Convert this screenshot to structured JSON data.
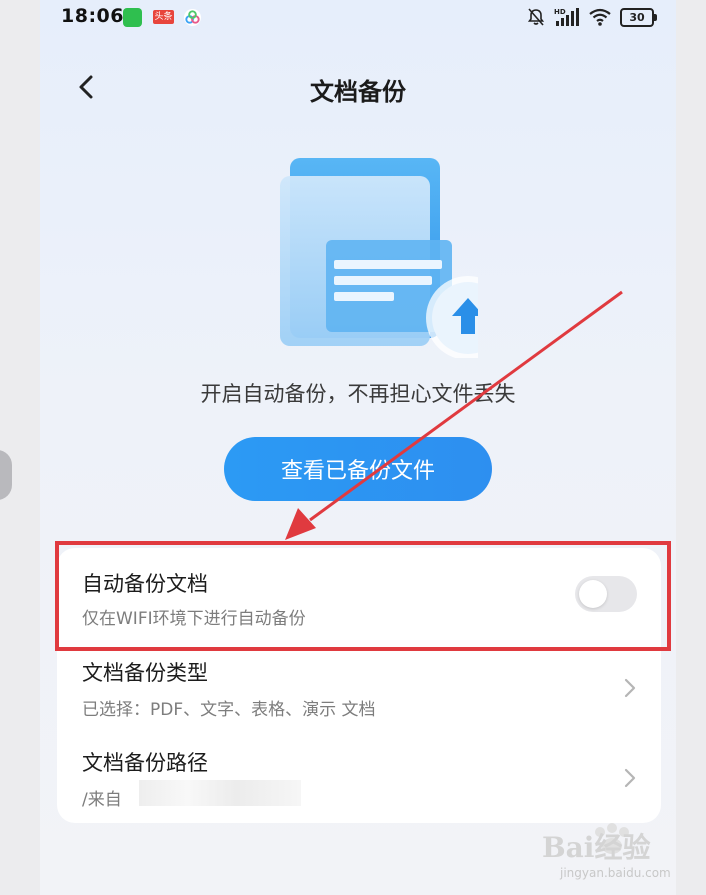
{
  "status_bar": {
    "time": "18:06",
    "apps": [
      "evernote-green",
      "toutiao-red",
      "cloud-app"
    ],
    "toutiao_label": "头条",
    "battery": "30",
    "icons": [
      "mute-bell-icon",
      "hd-signal-icon",
      "wifi-icon",
      "battery-icon"
    ]
  },
  "header": {
    "title": "文档备份",
    "back_icon": "chevron-left-icon"
  },
  "hero": {
    "tagline": "开启自动备份，不再担心文件丢失",
    "view_button": "查看已备份文件"
  },
  "settings": {
    "auto_backup": {
      "title": "自动备份文档",
      "subtitle": "仅在WIFI环境下进行自动备份",
      "enabled": false
    },
    "backup_type": {
      "title": "文档备份类型",
      "subtitle": "已选择：PDF、文字、表格、演示 文档"
    },
    "backup_path": {
      "title": "文档备份路径",
      "subtitle": "/来自"
    }
  },
  "watermark": {
    "text": "Bai经验",
    "url": "jingyan.baidu.com"
  },
  "colors": {
    "accent": "#2c9af4",
    "highlight": "#e03a3f",
    "background": "#eef2f9"
  }
}
